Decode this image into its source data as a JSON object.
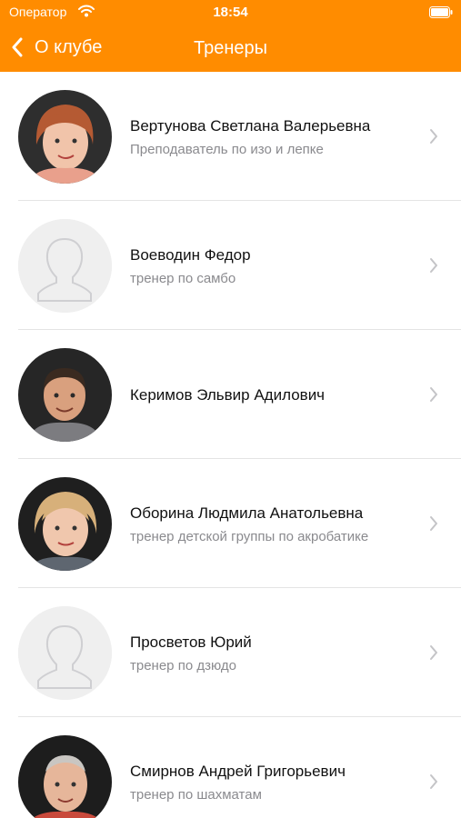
{
  "status_bar": {
    "carrier": "Оператор",
    "time": "18:54"
  },
  "nav": {
    "back_label": "О клубе",
    "title": "Тренеры"
  },
  "colors": {
    "accent": "#FF8C00",
    "separator": "#E4E4E4",
    "subtitle": "#8A8A8E"
  },
  "trainers": [
    {
      "name": "Вертунова Светлана Валерьевна",
      "role": "Преподаватель по изо и лепке",
      "avatar": "photo-woman-red-hair"
    },
    {
      "name": "Воеводин Федор",
      "role": "тренер по самбо",
      "avatar": "placeholder-person-icon"
    },
    {
      "name": "Керимов Эльвир Адилович",
      "role": "",
      "avatar": "photo-man-dark-hair"
    },
    {
      "name": "Оборина Людмила Анатольевна",
      "role": "тренер детской группы по акробатике",
      "avatar": "photo-woman-blonde"
    },
    {
      "name": "Просветов Юрий",
      "role": "тренер по дзюдо",
      "avatar": "placeholder-person-icon"
    },
    {
      "name": "Смирнов Андрей Григорьевич",
      "role": "тренер по шахматам",
      "avatar": "photo-man-grey-hair"
    }
  ]
}
